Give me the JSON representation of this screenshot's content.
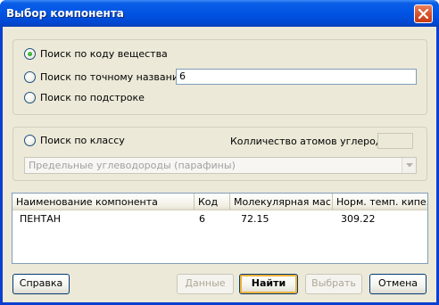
{
  "window": {
    "title": "Выбор компонента"
  },
  "search": {
    "by_code_label": "Поиск по коду вещества",
    "by_exact_name_label": "Поиск по точному названию",
    "exact_name_value": "6",
    "by_substring_label": "Поиск по подстроке",
    "selected": "by_code"
  },
  "class_search": {
    "label": "Поиск по классу",
    "carbon_count_label": "Колличество атомов углерода:",
    "carbon_count_value": "",
    "class_selected": "Предельные углеводороды (парафины)"
  },
  "results": {
    "columns": [
      "Наименование компонента",
      "Код",
      "Молекулярная мас...",
      "Норм. темп. кипе..."
    ],
    "rows": [
      [
        "ПЕНТАН",
        "6",
        "72.15",
        "309.22"
      ]
    ]
  },
  "buttons": {
    "help": "Справка",
    "data": "Данные",
    "find": "Найти",
    "select": "Выбрать",
    "cancel": "Отмена"
  }
}
